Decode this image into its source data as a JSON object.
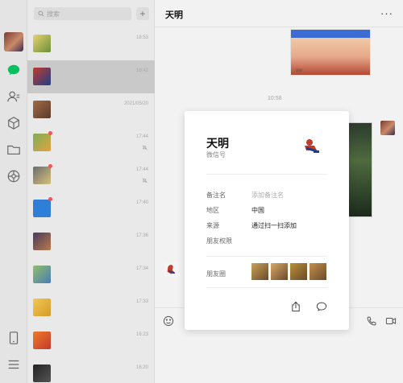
{
  "search": {
    "placeholder": "搜索",
    "add_label": "+"
  },
  "chat_list": [
    {
      "time": "18:53",
      "colors": [
        "#e6d36f",
        "#6c8f3a"
      ],
      "muted": false,
      "unread": false,
      "active": false
    },
    {
      "time": "18:42",
      "colors": [
        "#c23a2a",
        "#1e3f8a"
      ],
      "muted": false,
      "unread": false,
      "active": true
    },
    {
      "time": "2021/05/20",
      "colors": [
        "#a26b46",
        "#5a3a2c"
      ],
      "muted": false,
      "unread": false,
      "active": false
    },
    {
      "time": "17:44",
      "colors": [
        "#7fae5a",
        "#e2a33c"
      ],
      "muted": true,
      "unread": true,
      "active": false
    },
    {
      "time": "17:44",
      "colors": [
        "#6c6c6c",
        "#d6c27a"
      ],
      "muted": true,
      "unread": true,
      "active": false
    },
    {
      "time": "17:40",
      "colors": [
        "#2f7ed8",
        "#2f7ed8"
      ],
      "muted": false,
      "unread": true,
      "active": false
    },
    {
      "time": "17:36",
      "colors": [
        "#4a3b5c",
        "#b87a4a"
      ],
      "muted": false,
      "unread": false,
      "active": false
    },
    {
      "time": "17:34",
      "colors": [
        "#8fbf6a",
        "#4b7bb6"
      ],
      "muted": false,
      "unread": false,
      "active": false
    },
    {
      "time": "17:33",
      "colors": [
        "#f0c850",
        "#d89a2a"
      ],
      "muted": false,
      "unread": false,
      "active": false
    },
    {
      "time": "16:23",
      "colors": [
        "#f07a2a",
        "#c23a2a"
      ],
      "muted": false,
      "unread": false,
      "active": false
    },
    {
      "time": "16:20",
      "colors": [
        "#222222",
        "#555555"
      ],
      "muted": false,
      "unread": false,
      "active": false
    }
  ],
  "chat": {
    "title": "天明",
    "more": "···",
    "timestamp": "10:58",
    "sticker_caption": "表情"
  },
  "profile": {
    "name": "天明",
    "wechat_id_label": "微信号",
    "fields": [
      {
        "label": "备注名",
        "value": "添加备注名",
        "placeholder": true
      },
      {
        "label": "地区",
        "value": "中国",
        "placeholder": false
      },
      {
        "label": "来源",
        "value": "通过扫一扫添加",
        "placeholder": false
      },
      {
        "label": "朋友权限",
        "value": "",
        "placeholder": false
      }
    ],
    "moments_label": "朋友圈",
    "moments_colors": [
      "#c9a25a",
      "#d8a86a",
      "#b8903a",
      "#c48f4e"
    ]
  },
  "colors": {
    "accent": "#07c160",
    "unread": "#fa5151"
  }
}
